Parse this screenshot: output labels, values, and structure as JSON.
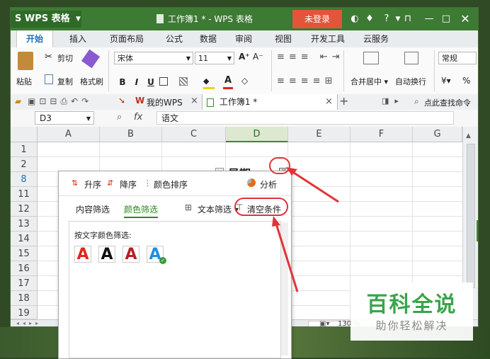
{
  "titlebar": {
    "app_name": "WPS 表格",
    "doc_title": "工作簿1 * - WPS 表格",
    "login_label": "未登录",
    "question": "?"
  },
  "menu_tabs": [
    "开始",
    "插入",
    "页面布局",
    "公式",
    "数据",
    "审阅",
    "视图",
    "开发工具",
    "云服务"
  ],
  "ribbon": {
    "paste": "粘贴",
    "cut": "剪切",
    "copy": "复制",
    "format_painter": "格式刷",
    "font_name": "宋体",
    "font_size": "11",
    "bold": "B",
    "italic": "I",
    "underline": "U",
    "merge": "合并居中",
    "wrap": "自动换行",
    "number_format": "常规",
    "percent": "%"
  },
  "doc_tabs": {
    "my_wps": "我的WPS",
    "workbook": "工作簿1 *",
    "search": "点此查找命令"
  },
  "formula_bar": {
    "cell_ref": "D3",
    "fx": "fx",
    "value": "语文"
  },
  "grid": {
    "columns": [
      "A",
      "B",
      "C",
      "D",
      "E",
      "F",
      "G"
    ],
    "rows": [
      "1",
      "2",
      "8",
      "11",
      "12",
      "13",
      "14",
      "15",
      "16",
      "17",
      "18",
      "19"
    ],
    "header_cell": "星期一"
  },
  "filter_popup": {
    "sort_asc": "升序",
    "sort_desc": "降序",
    "color_sort": "颜色排序",
    "analyze": "分析",
    "tab_content": "内容筛选",
    "tab_color": "颜色筛选",
    "text_filter": "文本筛选",
    "clear": "清空条件",
    "font_color_label": "按文字颜色筛选:",
    "swatch_letter": "A",
    "colors": {
      "red": "#e0261f",
      "black": "#111111",
      "darkred": "#b81e24",
      "blue": "#1f8fe0",
      "accent_green": "#3a8a2a"
    }
  },
  "status": {
    "zoom": "130 %"
  },
  "watermark": {
    "title": "百科全说",
    "subtitle": "助你轻松解决"
  }
}
